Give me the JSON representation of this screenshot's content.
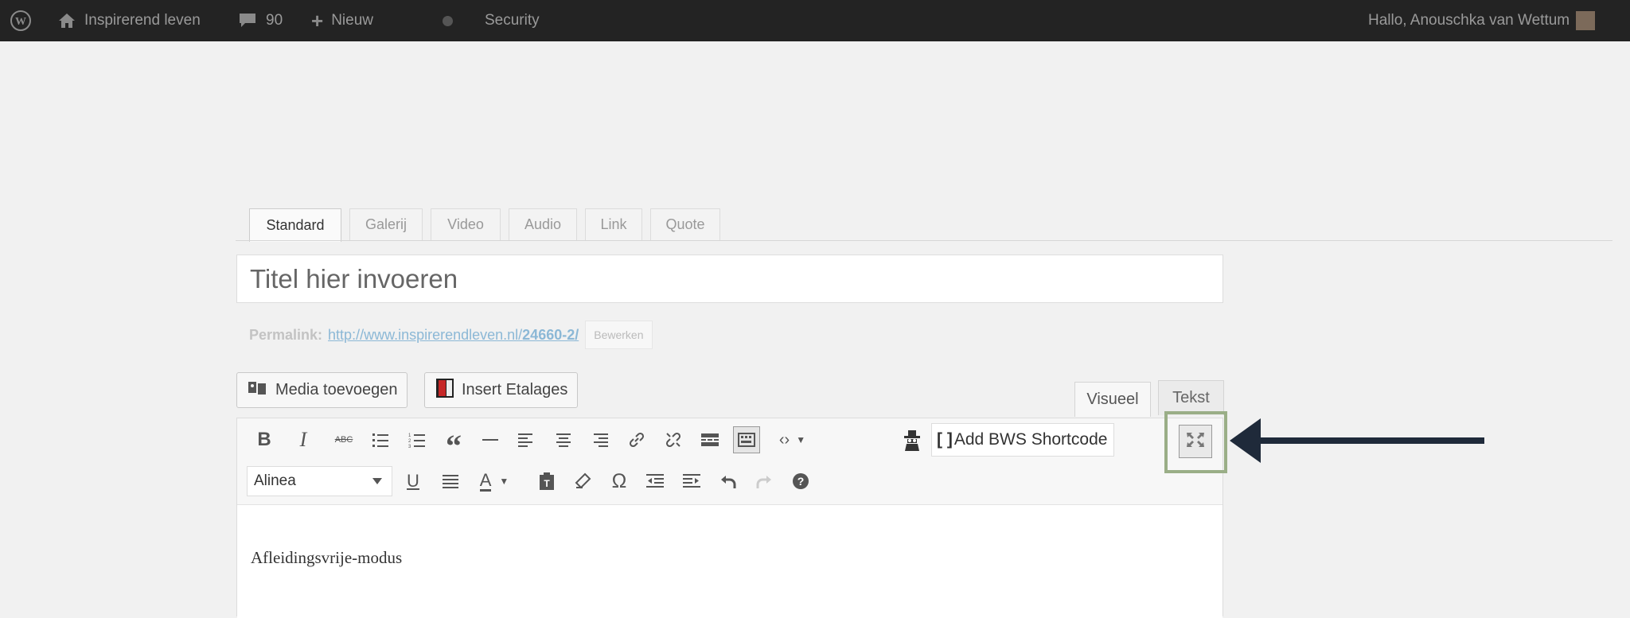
{
  "admin_bar": {
    "site_name": "Inspirerend leven",
    "comments_count": "90",
    "new_label": "Nieuw",
    "security_label": "Security",
    "greeting": "Hallo, Anouschka van Wettum"
  },
  "format_tabs": [
    "Standard",
    "Galerij",
    "Video",
    "Audio",
    "Link",
    "Quote"
  ],
  "title": {
    "placeholder": "Titel hier invoeren"
  },
  "permalink": {
    "label": "Permalink:",
    "url_prefix": "http://www.inspirerendleven.nl/",
    "url_slug": "24660-2/",
    "edit_label": "Bewerken"
  },
  "media_buttons": {
    "add_media": "Media toevoegen",
    "insert_etalages": "Insert Etalages"
  },
  "editor_tabs": {
    "visual": "Visueel",
    "text": "Tekst"
  },
  "toolbar": {
    "format_select": "Alinea",
    "bws_shortcode": "Add BWS Shortcode",
    "row1_icons": [
      "bold-icon",
      "italic-icon",
      "strikethrough-icon",
      "bulleted-list-icon",
      "numbered-list-icon",
      "blockquote-icon",
      "horizontal-line-icon",
      "align-left-icon",
      "align-center-icon",
      "align-right-icon",
      "link-icon",
      "unlink-icon",
      "read-more-icon",
      "toolbar-toggle-icon",
      "code-icon",
      "spy-icon",
      "bws-shortcode-icon",
      "distraction-free-icon"
    ],
    "row2_icons": [
      "underline-icon",
      "justify-icon",
      "text-color-icon",
      "paste-text-icon",
      "clear-formatting-icon",
      "special-character-icon",
      "outdent-icon",
      "indent-icon",
      "undo-icon",
      "redo-icon",
      "help-icon"
    ]
  },
  "content": {
    "text": "Afleidingsvrije-modus"
  },
  "colors": {
    "admin_bar": "#232323",
    "highlight_border": "#9aae87",
    "arrow": "#1f2a3a"
  }
}
